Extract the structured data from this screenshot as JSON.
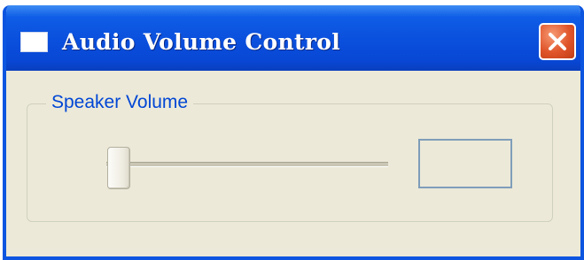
{
  "window": {
    "title": "Audio Volume Control",
    "icon": "window-icon",
    "close_icon": "close-icon",
    "title_color": "#ffffff",
    "titlebar_color": "#0a4fdd",
    "close_button_color": "#e0542a"
  },
  "speaker_group": {
    "label": "Speaker Volume",
    "label_color": "#0046d5",
    "slider": {
      "value_fraction": 0.0
    },
    "value_display": ""
  }
}
